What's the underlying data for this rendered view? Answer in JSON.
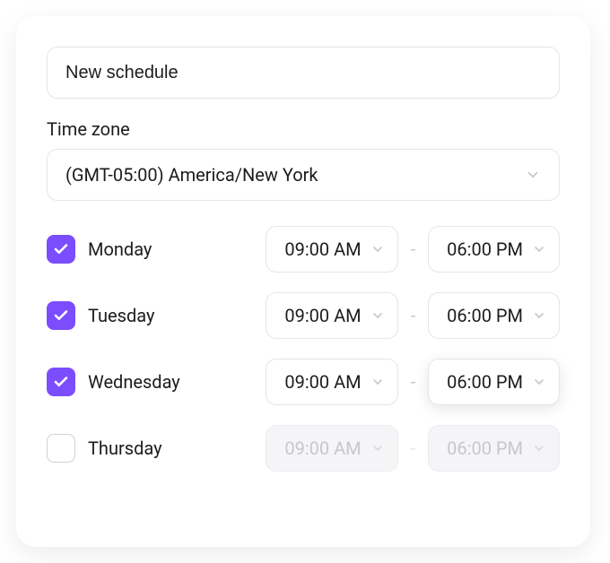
{
  "form": {
    "name_placeholder": "New schedule",
    "timezone_label": "Time zone",
    "timezone_value": "(GMT-05:00) America/New York"
  },
  "days": [
    {
      "label": "Monday",
      "checked": true,
      "start": "09:00 AM",
      "end": "06:00 PM"
    },
    {
      "label": "Tuesday",
      "checked": true,
      "start": "09:00 AM",
      "end": "06:00 PM"
    },
    {
      "label": "Wednesday",
      "checked": true,
      "start": "09:00 AM",
      "end": "06:00 PM"
    },
    {
      "label": "Thursday",
      "checked": false,
      "start": "09:00 AM",
      "end": "06:00 PM"
    }
  ],
  "colors": {
    "accent": "#7c4dff"
  }
}
